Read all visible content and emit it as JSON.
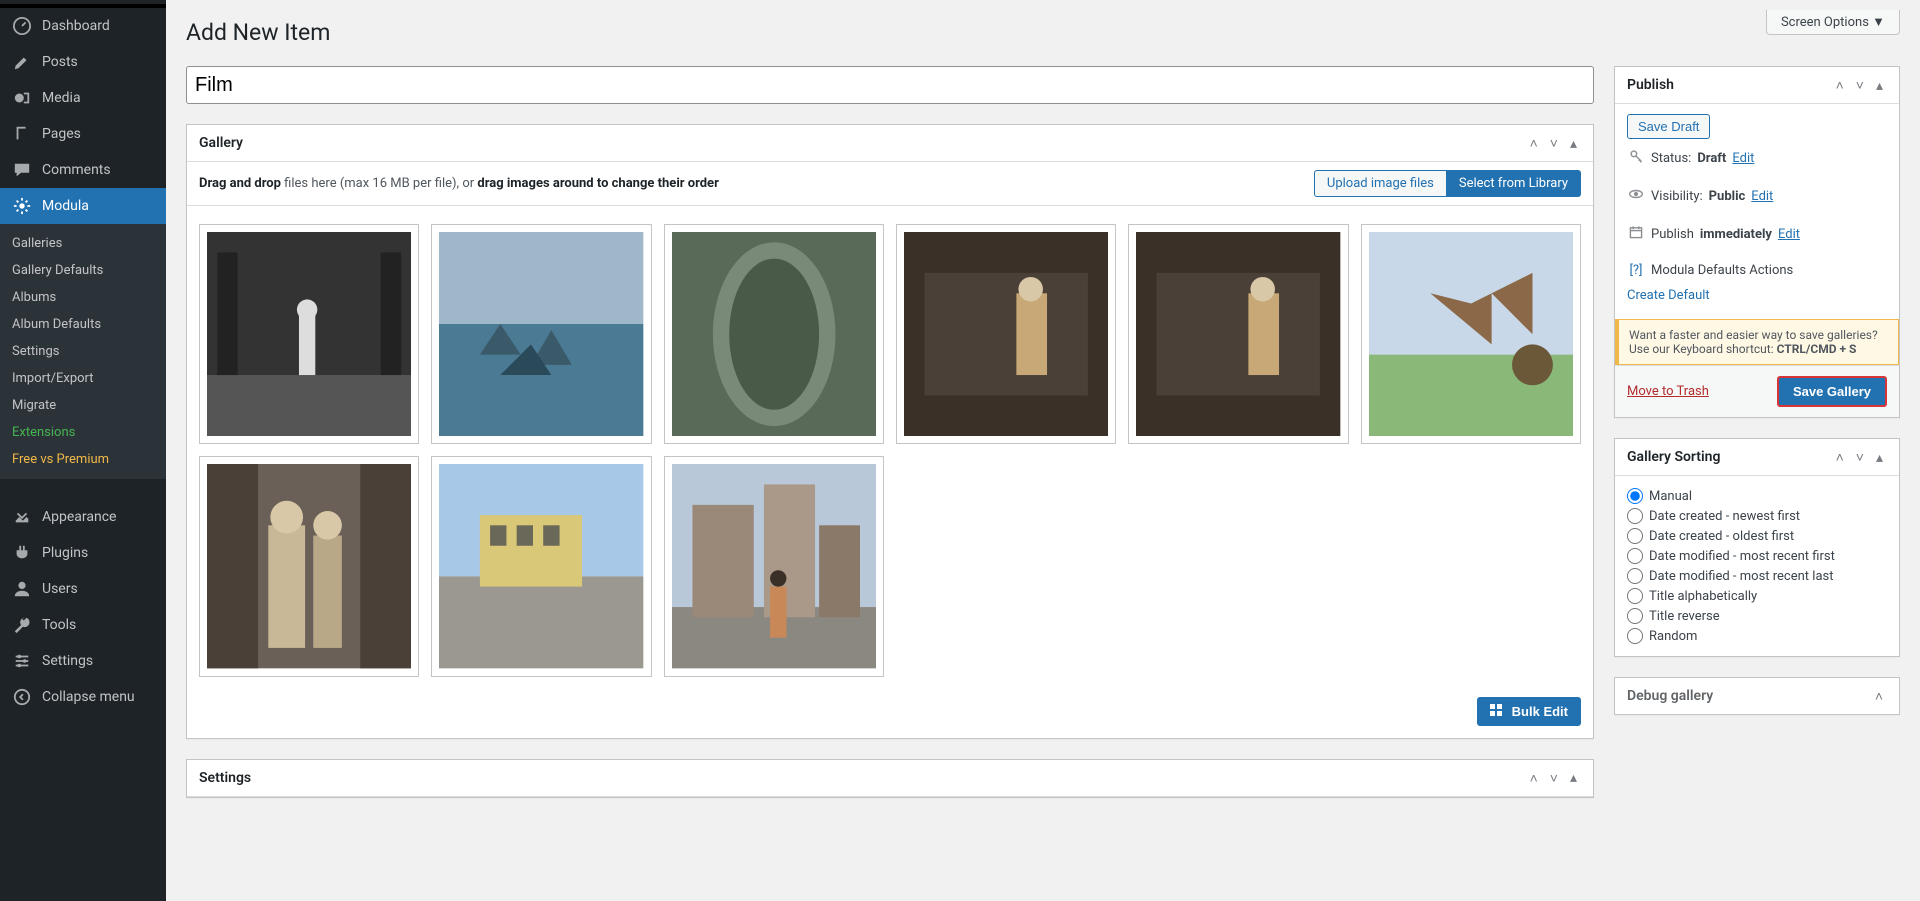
{
  "page": {
    "title": "Add New Item",
    "screen_options": "Screen Options ▼",
    "post_title": "Film"
  },
  "sidebar": {
    "items": [
      {
        "label": "Dashboard",
        "icon": "dashboard"
      },
      {
        "label": "Posts",
        "icon": "posts"
      },
      {
        "label": "Media",
        "icon": "media"
      },
      {
        "label": "Pages",
        "icon": "pages"
      },
      {
        "label": "Comments",
        "icon": "comments"
      },
      {
        "label": "Modula",
        "icon": "modula"
      }
    ],
    "sub": [
      {
        "label": "Galleries"
      },
      {
        "label": "Gallery Defaults"
      },
      {
        "label": "Albums"
      },
      {
        "label": "Album Defaults"
      },
      {
        "label": "Settings"
      },
      {
        "label": "Import/Export"
      },
      {
        "label": "Migrate"
      },
      {
        "label": "Extensions",
        "class": "green"
      },
      {
        "label": "Free vs Premium",
        "class": "yellow"
      }
    ],
    "items2": [
      {
        "label": "Appearance",
        "icon": "appearance"
      },
      {
        "label": "Plugins",
        "icon": "plugins"
      },
      {
        "label": "Users",
        "icon": "users"
      },
      {
        "label": "Tools",
        "icon": "tools"
      },
      {
        "label": "Settings",
        "icon": "settings"
      },
      {
        "label": "Collapse menu",
        "icon": "collapse"
      }
    ]
  },
  "gallery": {
    "heading": "Gallery",
    "drag_prefix": "Drag and drop",
    "drag_mid": " files here (max 16 MB per file), or ",
    "drag_suffix": "drag images around to change their order",
    "upload_btn": "Upload image files",
    "select_btn": "Select from Library",
    "bulk_edit": "Bulk Edit"
  },
  "settings_panel": {
    "heading": "Settings"
  },
  "publish": {
    "heading": "Publish",
    "save_draft": "Save Draft",
    "status_label": "Status:",
    "status_value": "Draft",
    "visibility_label": "Visibility:",
    "visibility_value": "Public",
    "schedule_label": "Publish",
    "schedule_value": "immediately",
    "edit": "Edit",
    "defaults_actions": "Modula Defaults Actions",
    "create_default": "Create Default",
    "tip": "Want a faster and easier way to save galleries? Use our Keyboard shortcut: ",
    "tip_shortcut": "CTRL/CMD + S",
    "trash": "Move to Trash",
    "save": "Save Gallery"
  },
  "sorting": {
    "heading": "Gallery Sorting",
    "options": [
      "Manual",
      "Date created - newest first",
      "Date created - oldest first",
      "Date modified - most recent first",
      "Date modified - most recent last",
      "Title alphabetically",
      "Title reverse",
      "Random"
    ]
  },
  "debug": {
    "heading": "Debug gallery"
  }
}
